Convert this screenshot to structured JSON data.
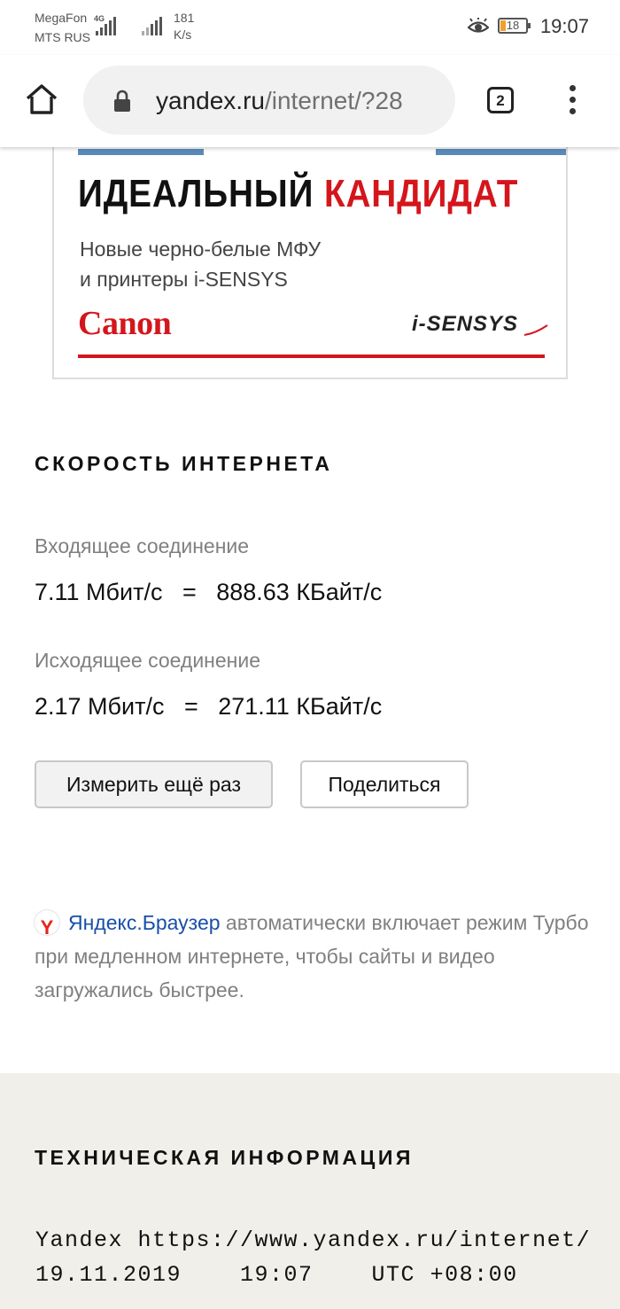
{
  "status_bar": {
    "carrier1": "MegaFon",
    "carrier2": "MTS RUS",
    "network_type": "4G",
    "speed_value": "181",
    "speed_unit": "K/s",
    "battery_level": "18",
    "time": "19:07"
  },
  "browser": {
    "url_host": "yandex.ru",
    "url_path": "/internet/?28",
    "tab_count": "2",
    "icons": [
      "home-icon",
      "lock-icon",
      "tabs-icon",
      "menu-dots-icon"
    ]
  },
  "ad": {
    "headline_black": "ИДЕАЛЬНЫЙ",
    "headline_red": "КАНДИДАТ",
    "subline1": "Новые черно-белые МФУ",
    "subline2": "и принтеры i-SENSYS",
    "brand": "Canon",
    "product": "i-SENSYS",
    "colors": {
      "red": "#d4161c",
      "stripe": "#5b89b8"
    }
  },
  "speed": {
    "title": "СКОРОСТЬ ИНТЕРНЕТА",
    "incoming_label": "Входящее соединение",
    "incoming_value": "7.11 Мбит/с   =   888.63 КБайт/с",
    "outgoing_label": "Исходящее соединение",
    "outgoing_value": "2.17 Мбит/с   =   271.11 КБайт/с",
    "measure_button": "Измерить ещё раз",
    "share_button": "Поделиться"
  },
  "note": {
    "link": "Яндекс.Браузер",
    "text": " автоматически включает режим Турбо при медленном интернете, чтобы сайты и видео загружались быстрее.",
    "logo_letter": "Y"
  },
  "tech": {
    "title": "ТЕХНИЧЕСКАЯ ИНФОРМАЦИЯ",
    "line1": "Yandex https://www.yandex.ru/internet/",
    "line2": "19.11.2019    19:07    UTC +08:00",
    "background": "#f1efea"
  }
}
